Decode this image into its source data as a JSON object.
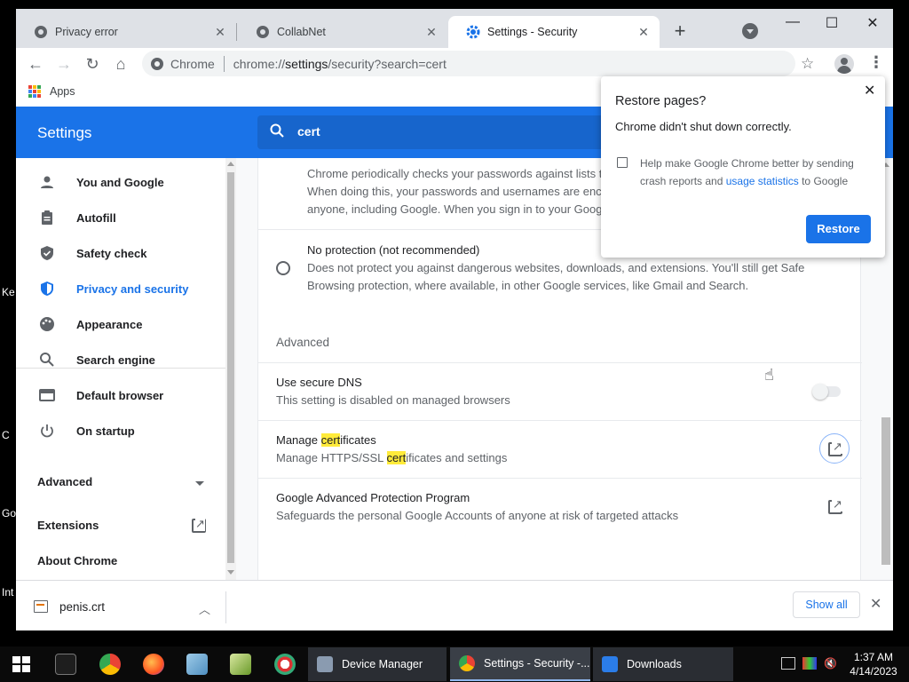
{
  "desktop": {
    "fragments": [
      "Ke",
      "C",
      "Go",
      "Int"
    ]
  },
  "tabs": [
    {
      "title": "Privacy error",
      "icon": "globe-icon"
    },
    {
      "title": "CollabNet",
      "icon": "globe-icon"
    },
    {
      "title": "Settings - Security",
      "icon": "gear-icon",
      "active": true
    }
  ],
  "omnibox": {
    "chip": "Chrome",
    "url_prefix": "chrome://",
    "url_host": "settings",
    "url_rest": "/security?search=cert"
  },
  "bookmarks": {
    "apps_label": "Apps"
  },
  "settings": {
    "title": "Settings",
    "search_value": "cert",
    "nav": [
      {
        "label": "You and Google",
        "icon": "person-icon"
      },
      {
        "label": "Autofill",
        "icon": "clipboard-icon"
      },
      {
        "label": "Safety check",
        "icon": "shield-check-icon"
      },
      {
        "label": "Privacy and security",
        "icon": "shield-icon",
        "selected": true
      },
      {
        "label": "Appearance",
        "icon": "palette-icon"
      },
      {
        "label": "Search engine",
        "icon": "search-icon"
      },
      {
        "label": "Default browser",
        "icon": "browser-icon"
      },
      {
        "label": "On startup",
        "icon": "power-icon"
      }
    ],
    "advanced_label": "Advanced",
    "extensions_label": "Extensions",
    "about_label": "About Chrome"
  },
  "content": {
    "partial_lines": [
      "Chrome periodically checks your passwords against lists t",
      "When doing this, your passwords and usernames are encr",
      "anyone, including Google. When you sign in to your Google"
    ],
    "no_protection_title": "No protection (not recommended)",
    "no_protection_desc1": "Does not protect you against dangerous websites, downloads, and extensions. You'll still get Safe",
    "no_protection_desc2": "Browsing protection, where available, in other Google services, like Gmail and Search.",
    "advanced_header": "Advanced",
    "secure_dns_title": "Use secure DNS",
    "secure_dns_desc": "This setting is disabled on managed browsers",
    "manage_certs": {
      "title_pre": "Manage ",
      "title_hl": "cert",
      "title_post": "ificates",
      "desc_pre": "Manage HTTPS/SSL ",
      "desc_hl": "cert",
      "desc_post": "ificates and settings"
    },
    "gapp_title": "Google Advanced Protection Program",
    "gapp_desc": "Safeguards the personal Google Accounts of anyone at risk of targeted attacks"
  },
  "popup": {
    "title": "Restore pages?",
    "message": "Chrome didn't shut down correctly.",
    "crash_pre": "Help make Google Chrome better by sending crash reports and ",
    "crash_link": "usage statistics",
    "crash_post": " to Google",
    "restore_label": "Restore"
  },
  "download": {
    "filename": "penis.crt",
    "show_all_label": "Show all"
  },
  "taskbar": {
    "buttons": [
      {
        "label": "Device Manager"
      },
      {
        "label": "Settings - Security -...",
        "active": true
      },
      {
        "label": "Downloads"
      }
    ],
    "time": "1:37 AM",
    "date": "4/14/2023"
  },
  "colors": {
    "accent": "#1a73e8",
    "highlight": "#ffeb3b"
  }
}
